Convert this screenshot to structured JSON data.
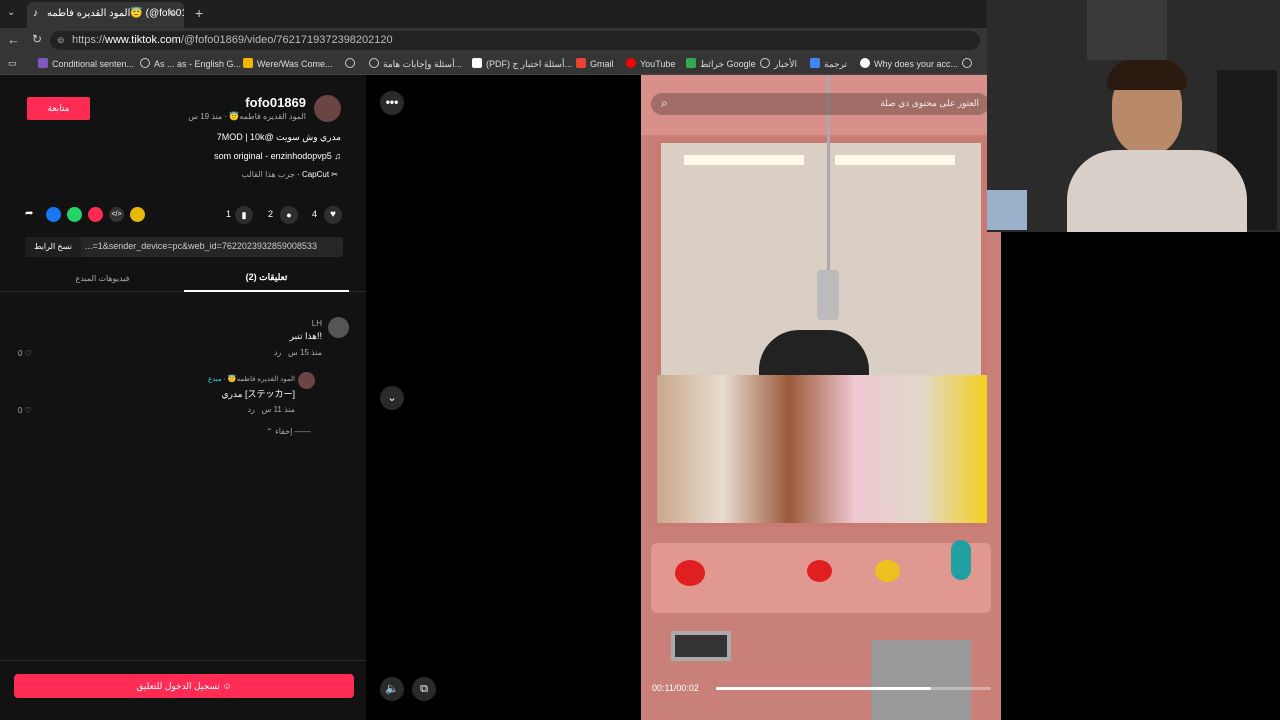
{
  "browser": {
    "tab_title": "المود القديره فاطمه😇 (@fofo01869)",
    "url_prefix": "https://",
    "url_host": "www.tiktok.com",
    "url_path": "/@fofo01869/video/7621719372398202120",
    "bookmarks": [
      "Conditional senten...",
      "As ... as - English G...",
      "Were/Was Come...",
      "أسئلة وإجابات هامة...",
      "(PDF) أسئلة اختبار ج...",
      "Gmail",
      "YouTube",
      "خرائط Google",
      "الأخبار",
      "ترجمة",
      "Why does your acc..."
    ]
  },
  "post": {
    "follow_label": "متابعة",
    "username": "fofo01869",
    "display_name": "المود القديره فاطمه😇",
    "time_ago": "منذ 19 س",
    "caption": "مدري وش سويت @7MOD | 10k",
    "sound": "som original - enzinhodopvp5",
    "capcut_label": "CapCut",
    "capcut_sub": "جرب هذا القالب",
    "likes": "4",
    "comments": "2",
    "saves": "1",
    "link_text": "...=1&sender_device=pc&web_id=7622023932859008533",
    "copy_link_label": "نسخ الرابط"
  },
  "tabs": {
    "comments": "تعليقات (2)",
    "creator_videos": "فيديوهات المبدع"
  },
  "comments": [
    {
      "user": "LH",
      "text": "هذا تنبر!!",
      "time": "منذ 15 س",
      "reply": "رد",
      "likes": "0"
    },
    {
      "user": "المود القديره فاطمه😇",
      "creator_badge": "مبدع",
      "text": "مدري [ステッカー]",
      "time": "منذ 11 س",
      "reply": "رد",
      "likes": "0"
    }
  ],
  "hide_label": "إخفاء",
  "login_button": "تسجيل الدخول للتعليق",
  "video": {
    "search_placeholder": "العثور على محتوى ذي صلة",
    "time": "00:11/00:02",
    "progress": 0.78
  },
  "colors": {
    "accent": "#fe2c55"
  }
}
